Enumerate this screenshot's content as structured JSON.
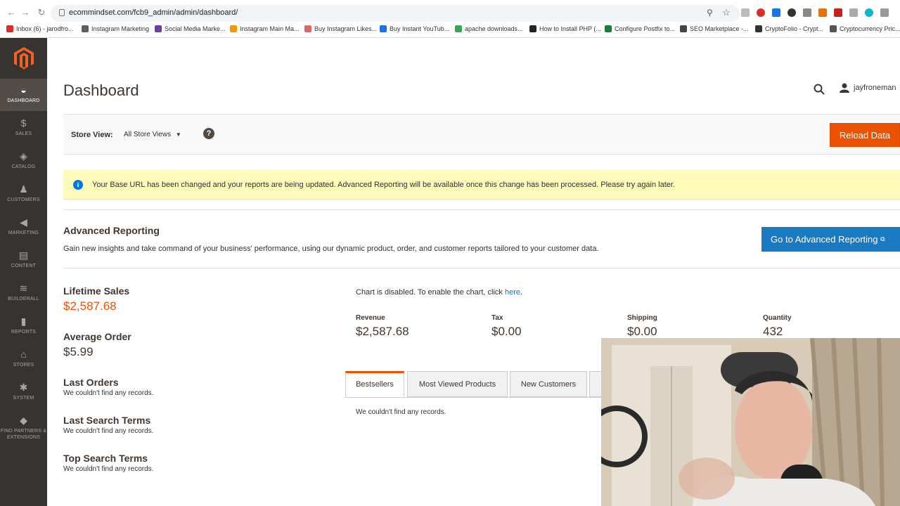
{
  "browser": {
    "url": "ecommindset.com/fcb9_admin/admin/dashboard/",
    "bookmarks": [
      {
        "label": "Inbox (6) - jarodfro...",
        "color": "#d93025"
      },
      {
        "label": "Instagram Marketing",
        "color": "#5f5f5f"
      },
      {
        "label": "Social Media Marke...",
        "color": "#6b3fa0"
      },
      {
        "label": "Instagram Main Ma...",
        "color": "#f29900"
      },
      {
        "label": "Buy Instagram Likes...",
        "color": "#e06666"
      },
      {
        "label": "Buy Instant YouTub...",
        "color": "#1a73e8"
      },
      {
        "label": "apache downloads...",
        "color": "#34a853"
      },
      {
        "label": "How to Install PHP (...",
        "color": "#222222"
      },
      {
        "label": "Configure Postfix to...",
        "color": "#188038"
      },
      {
        "label": "SEO Marketplace -...",
        "color": "#444444"
      },
      {
        "label": "CryptoFolio - Crypt...",
        "color": "#333333"
      },
      {
        "label": "Cryptocurrency Pric...",
        "color": "#555555"
      }
    ]
  },
  "sidebar": {
    "items": [
      {
        "label": "DASHBOARD",
        "icon": "dashboard-icon",
        "glyph": "◒"
      },
      {
        "label": "SALES",
        "icon": "dollar-icon",
        "glyph": "$"
      },
      {
        "label": "CATALOG",
        "icon": "box-icon",
        "glyph": "◈"
      },
      {
        "label": "CUSTOMERS",
        "icon": "person-icon",
        "glyph": "♟"
      },
      {
        "label": "MARKETING",
        "icon": "megaphone-icon",
        "glyph": "◀"
      },
      {
        "label": "CONTENT",
        "icon": "content-icon",
        "glyph": "▤"
      },
      {
        "label": "BUILDERALL",
        "icon": "builderall-icon",
        "glyph": "≋"
      },
      {
        "label": "REPORTS",
        "icon": "bar-chart-icon",
        "glyph": "▮"
      },
      {
        "label": "STORES",
        "icon": "store-icon",
        "glyph": "⌂"
      },
      {
        "label": "SYSTEM",
        "icon": "gear-icon",
        "glyph": "✱"
      },
      {
        "label": "FIND PARTNERS & EXTENSIONS",
        "icon": "extensions-icon",
        "glyph": "◆"
      }
    ]
  },
  "header": {
    "title": "Dashboard",
    "username": "jayfroneman"
  },
  "store_bar": {
    "label": "Store View:",
    "selected": "All Store Views",
    "help": "?",
    "reload_label": "Reload Data"
  },
  "notice": {
    "message": "Your Base URL has been changed and your reports are being updated. Advanced Reporting will be available once this change has been processed. Please try again later."
  },
  "advanced_reporting": {
    "title": "Advanced Reporting",
    "description": "Gain new insights and take command of your business' performance, using our dynamic product, order, and customer reports tailored to your customer data.",
    "button_label": "Go to Advanced Reporting"
  },
  "stats": {
    "lifetime_label": "Lifetime Sales",
    "lifetime_value": "$2,587.68",
    "average_label": "Average Order",
    "average_value": "$5.99"
  },
  "sections": [
    {
      "title": "Last Orders",
      "empty": "We couldn't find any records."
    },
    {
      "title": "Last Search Terms",
      "empty": "We couldn't find any records."
    },
    {
      "title": "Top Search Terms",
      "empty": "We couldn't find any records."
    }
  ],
  "chart": {
    "message": "Chart is disabled. To enable the chart, click ",
    "link": "here",
    "suffix": "."
  },
  "totals": [
    {
      "label": "Revenue",
      "value": "$2,587.68"
    },
    {
      "label": "Tax",
      "value": "$0.00"
    },
    {
      "label": "Shipping",
      "value": "$0.00"
    },
    {
      "label": "Quantity",
      "value": "432"
    }
  ],
  "tabs": {
    "items": [
      "Bestsellers",
      "Most Viewed Products",
      "New Customers"
    ],
    "empty": "We couldn't find any records."
  },
  "colors": {
    "accent": "#eb5202",
    "sidebar": "#373330",
    "link": "#1979c3"
  }
}
